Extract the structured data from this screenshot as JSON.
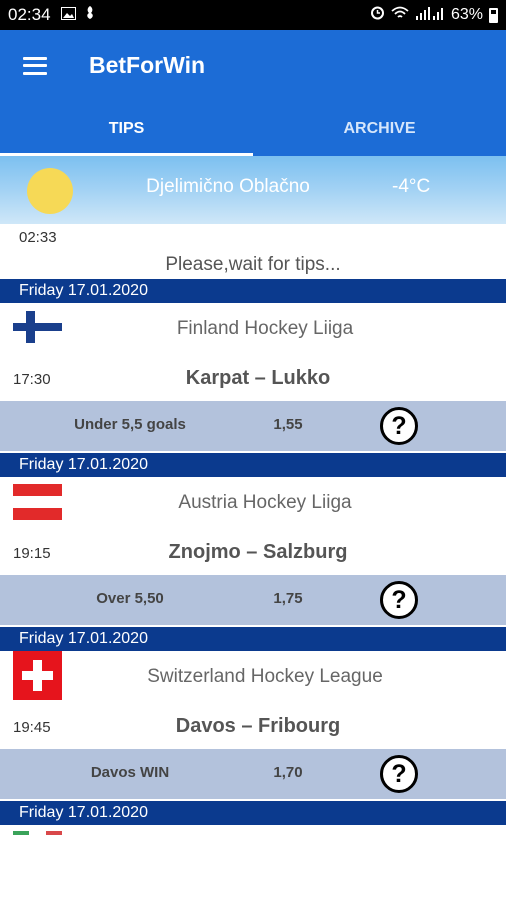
{
  "status_bar": {
    "time": "02:34",
    "battery": "63%"
  },
  "app": {
    "title": "BetForWin"
  },
  "tabs": [
    {
      "label": "TIPS",
      "active": true
    },
    {
      "label": "ARCHIVE",
      "active": false
    }
  ],
  "weather": {
    "description": "Djelimično Oblačno",
    "temperature": "-4°C",
    "icon": "sun-icon"
  },
  "update_time": "02:33",
  "wait_message": "Please,wait for tips...",
  "tips": [
    {
      "date": "Friday 17.01.2020",
      "league": "Finland Hockey Liiga",
      "time": "17:30",
      "match": "Karpat – Lukko",
      "tip": "Under 5,5 goals",
      "odds": "1,55",
      "flag": "finland-flag-icon"
    },
    {
      "date": "Friday 17.01.2020",
      "league": "Austria Hockey Liiga",
      "time": "19:15",
      "match": "Znojmo – Salzburg",
      "tip": "Over 5,50",
      "odds": "1,75",
      "flag": "austria-flag-icon"
    },
    {
      "date": "Friday 17.01.2020",
      "league": "Switzerland Hockey League",
      "time": "19:45",
      "match": "Davos – Fribourg",
      "tip": "Davos WIN",
      "odds": "1,70",
      "flag": "switzerland-flag-icon"
    },
    {
      "date": "Friday 17.01.2020"
    }
  ],
  "colors": {
    "primary": "#1c6cd6",
    "date_bar": "#0b3a8e",
    "tip_bar": "#b3c2dc",
    "sun": "#f6d956"
  }
}
